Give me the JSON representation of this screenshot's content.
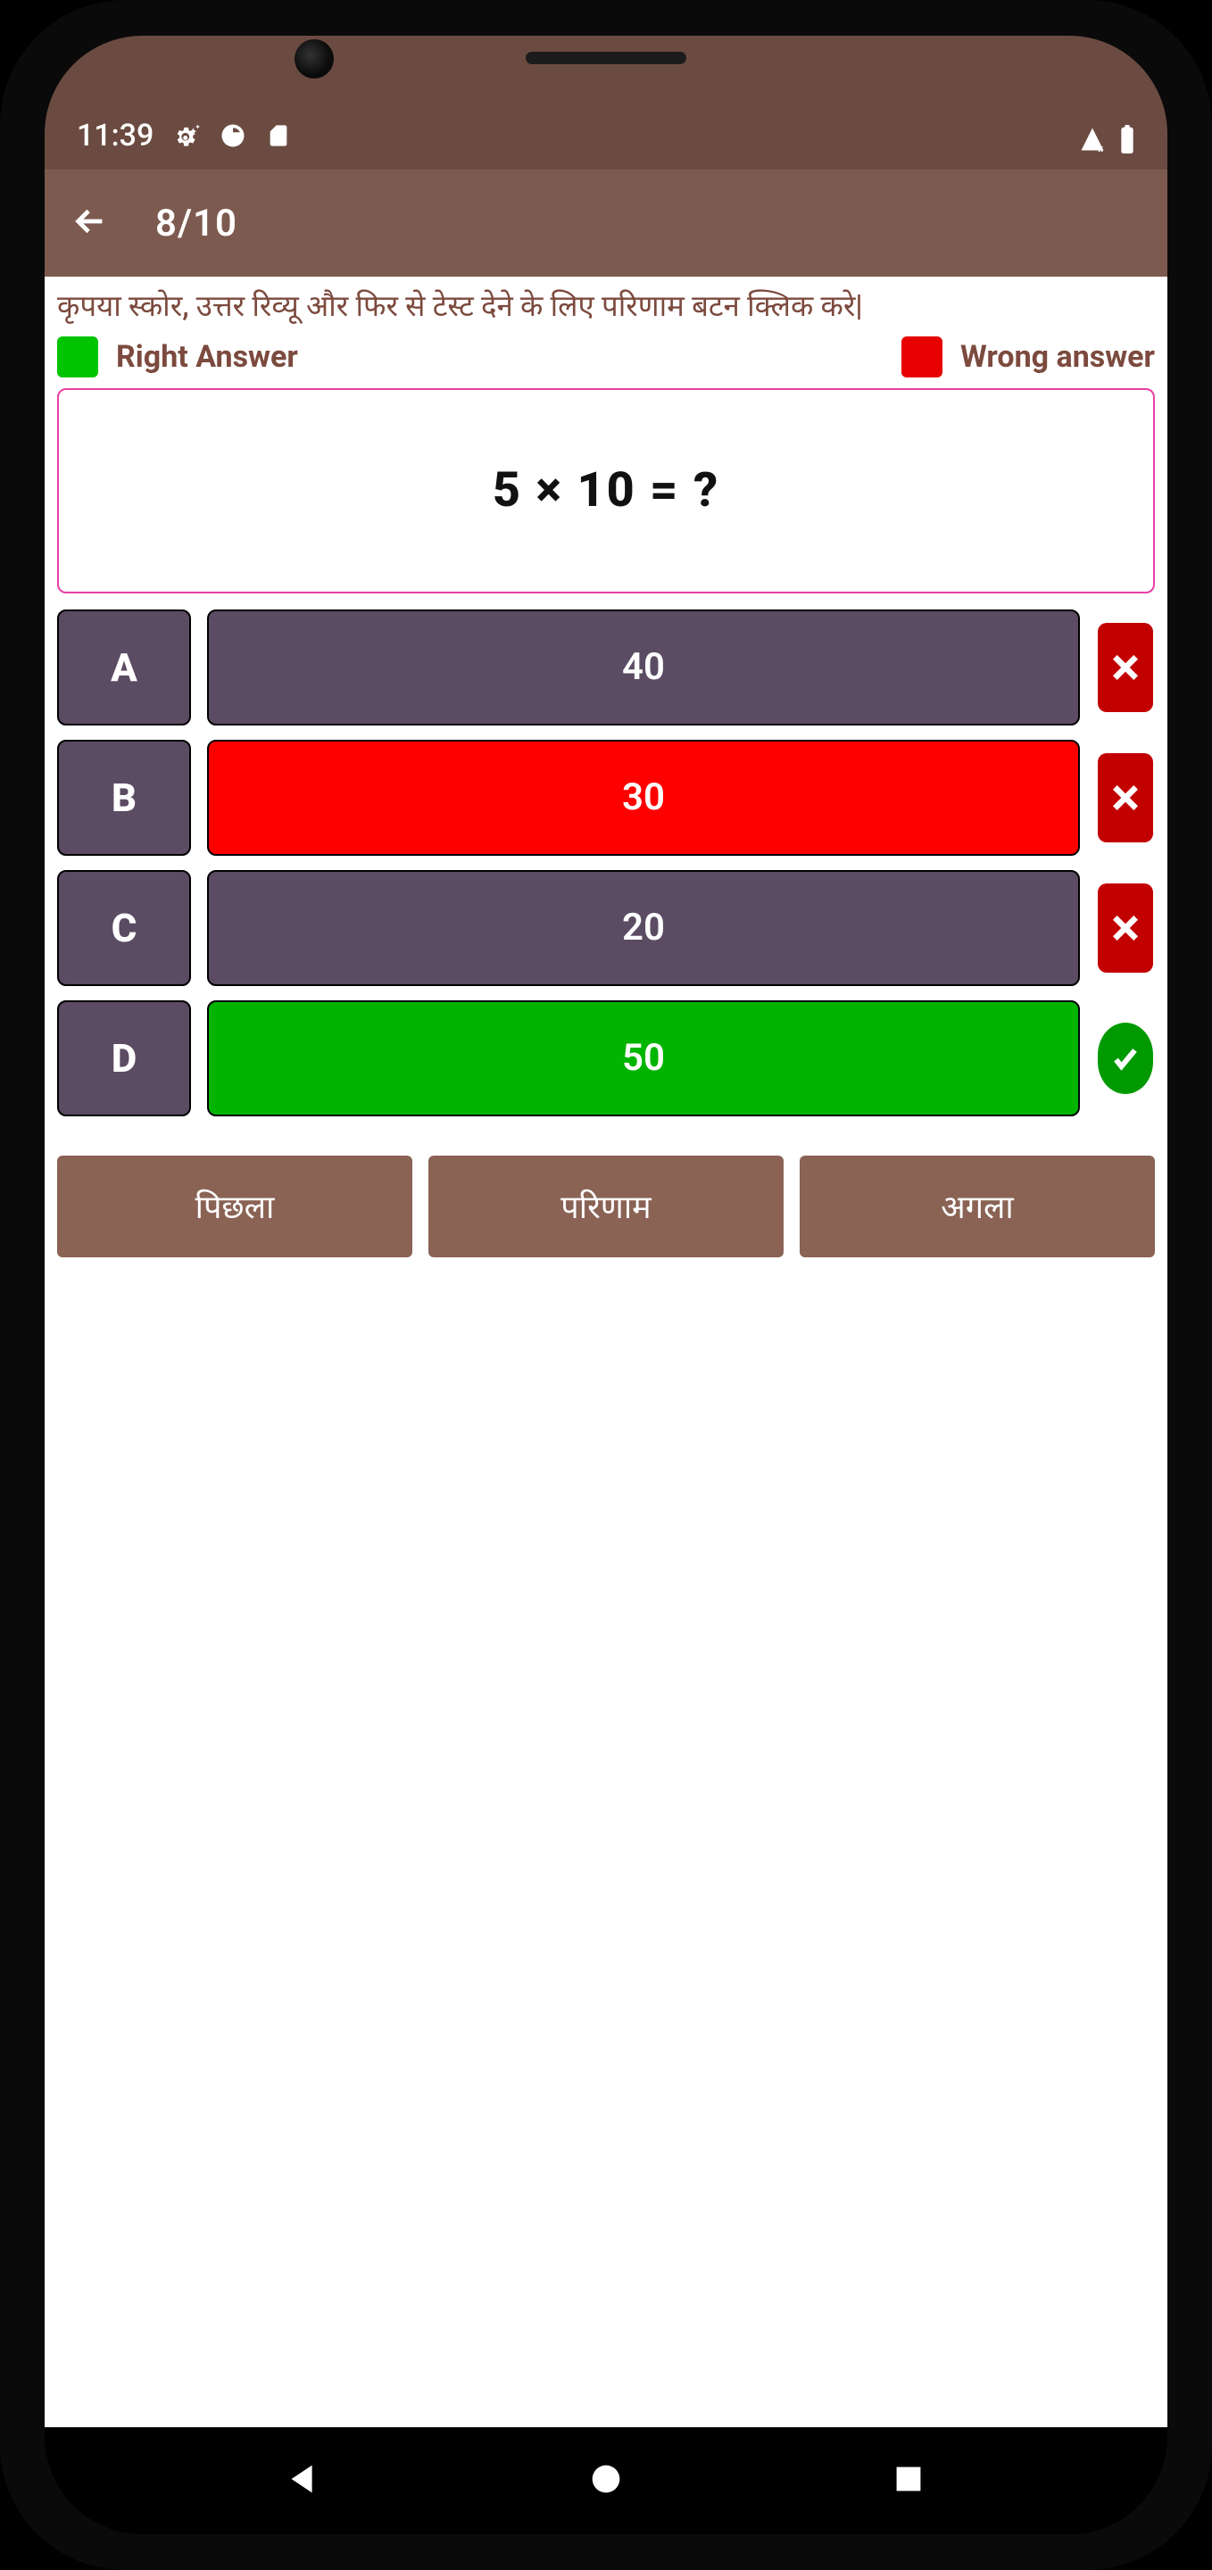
{
  "statusbar": {
    "time": "11:39"
  },
  "appbar": {
    "title": "8/10"
  },
  "instruction": "कृपया स्कोर, उत्तर रिव्यू और फिर से टेस्ट देने के लिए परिणाम बटन क्लिक करे|",
  "legend": {
    "right_label": "Right Answer",
    "wrong_label": "Wrong answer",
    "right_color": "#00c400",
    "wrong_color": "#e60000"
  },
  "question": "5 × 10 = ?",
  "options": [
    {
      "key": "A",
      "value": "40",
      "state": "default",
      "mark": "x"
    },
    {
      "key": "B",
      "value": "30",
      "state": "wrong",
      "mark": "x"
    },
    {
      "key": "C",
      "value": "20",
      "state": "default",
      "mark": "x"
    },
    {
      "key": "D",
      "value": "50",
      "state": "correct",
      "mark": "v"
    }
  ],
  "nav": {
    "prev": "पिछला",
    "result": "परिणाम",
    "next": "अगला"
  }
}
